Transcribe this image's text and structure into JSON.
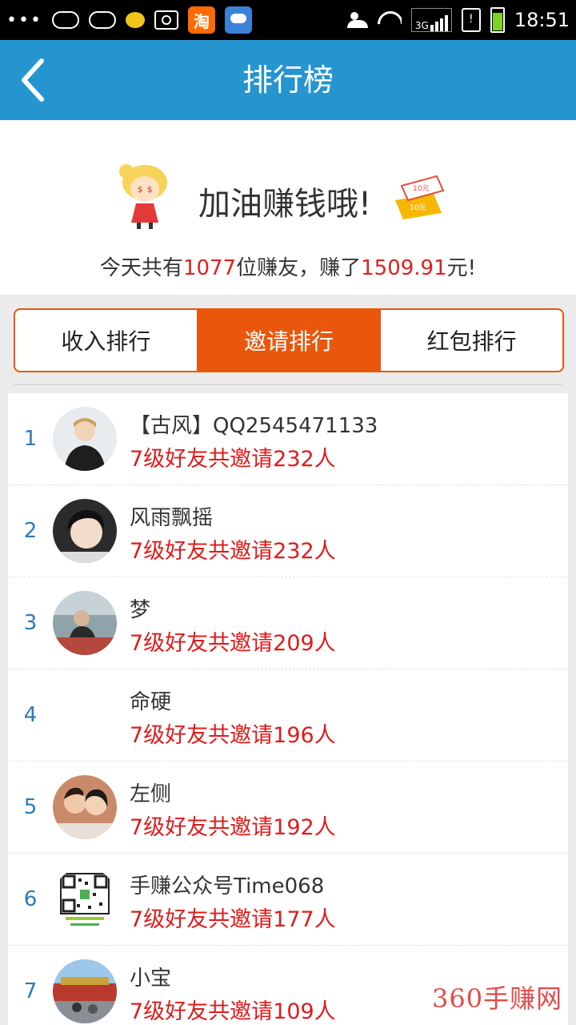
{
  "status_bar": {
    "time": "18:51",
    "network": "3G",
    "tao_icon_label": "淘",
    "icons": [
      "more-dots-icon",
      "cloud-icon",
      "cloud-outline-icon",
      "chat-bubble-icon",
      "camera-icon",
      "taobao-icon",
      "weather-icon",
      "person-icon",
      "wifi-icon",
      "signal-icon",
      "sim-alert-icon",
      "battery-icon"
    ]
  },
  "header": {
    "title": "排行榜",
    "back_icon": "chevron-left-icon"
  },
  "banner": {
    "slogan": "加油赚钱哦!",
    "summary_prefix": "今天共有",
    "user_count": "1077",
    "summary_middle": "位赚友，赚了",
    "amount": "1509.91",
    "summary_suffix": "元!"
  },
  "tabs": [
    {
      "label": "收入排行",
      "active": false
    },
    {
      "label": "邀请排行",
      "active": true
    },
    {
      "label": "红包排行",
      "active": false
    }
  ],
  "ranking": [
    {
      "rank": "1",
      "name": "【古风】QQ2545471133",
      "invite": "7级好友共邀请232人"
    },
    {
      "rank": "2",
      "name": "风雨飘摇",
      "invite": "7级好友共邀请232人"
    },
    {
      "rank": "3",
      "name": "梦",
      "invite": "7级好友共邀请209人"
    },
    {
      "rank": "4",
      "name": "命硬",
      "invite": "7级好友共邀请196人"
    },
    {
      "rank": "5",
      "name": "左侧",
      "invite": "7级好友共邀请192人"
    },
    {
      "rank": "6",
      "name": "手赚公众号Time068",
      "invite": "7级好友共邀请177人"
    },
    {
      "rank": "7",
      "name": "小宝",
      "invite": "7级好友共邀请109人"
    }
  ],
  "watermark": "360手赚网",
  "colors": {
    "header": "#2595d0",
    "accent": "#e8570c",
    "highlight": "#e02020",
    "rank": "#2a7ab8"
  }
}
